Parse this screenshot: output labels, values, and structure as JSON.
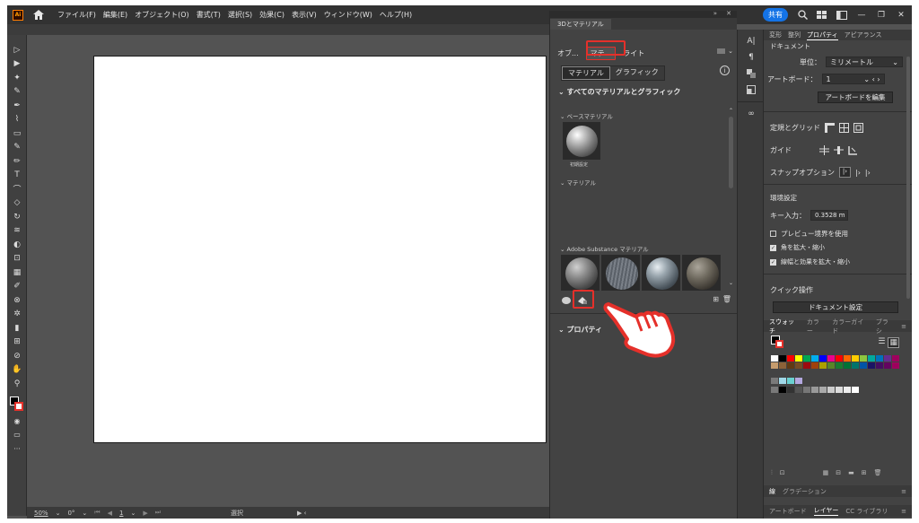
{
  "menubar": {
    "app_logo": "Ai",
    "items": [
      "ファイル(F)",
      "編集(E)",
      "オブジェクト(O)",
      "書式(T)",
      "選択(S)",
      "効果(C)",
      "表示(V)",
      "ウィンドウ(W)",
      "ヘルプ(H)"
    ],
    "share_label": "共有",
    "icons": [
      "search-icon",
      "arrange-icon",
      "panel-icon",
      "minimize-icon",
      "restore-icon",
      "close-icon"
    ]
  },
  "panel3d": {
    "tab_label": "3Dとマテリアル",
    "mode_tabs": [
      "オブ...",
      "マテ...",
      "ライト"
    ],
    "segments": [
      "マテリアル",
      "グラフィック"
    ],
    "all_header": "すべてのマテリアルとグラフィック",
    "base_header": "ベースマテリアル",
    "base_item_label": "初期設定",
    "material_header": "マテリアル",
    "substance_header": "Adobe Substance マテリアル",
    "properties_header": "プロパティ"
  },
  "props": {
    "tabs": [
      "変形",
      "整列",
      "プロパティ",
      "アピアランス"
    ],
    "active_tab": "プロパティ",
    "document_header": "ドキュメント",
    "unit_label": "単位：",
    "unit_value": "ミリメートル",
    "artboard_label": "アートボード：",
    "artboard_value": "1",
    "edit_artboard_btn": "アートボードを編集",
    "ruler_grid_label": "定規とグリッド",
    "guide_label": "ガイド",
    "snap_label": "スナップオプション",
    "prefs_header": "環境設定",
    "key_input_label": "キー入力：",
    "key_input_value": "0.3528 m",
    "preview_bounds": "プレビュー境界を使用",
    "scale_corners": "角を拡大・縮小",
    "scale_strokes": "線幅と効果を拡大・縮小",
    "quick_actions": "クイック操作",
    "doc_settings_btn": "ドキュメント設定"
  },
  "swatches": {
    "tabs": [
      "スウォッチ",
      "カラー",
      "カラーガイド",
      "ブラシ"
    ],
    "colors": [
      "#ffffff",
      "#000000",
      "#ff0000",
      "#ffff00",
      "#00a651",
      "#00aeef",
      "#0000ff",
      "#ec008c",
      "#ff0000",
      "#ff6600",
      "#ffcc00",
      "#8dc63f",
      "#00a99d",
      "#0072bc",
      "#662d91",
      "#9e005d",
      "#c69c6d",
      "#8c6239",
      "#603913",
      "#754c24",
      "#9e0b0f",
      "#a0410d",
      "#aba000",
      "#598527",
      "#1a7b30",
      "#007236",
      "#00746b",
      "#0054a6",
      "#1b1464",
      "#440e62",
      "#630460",
      "#9e005d"
    ]
  },
  "layers": {
    "tabs": [
      "線",
      "グラデーション"
    ],
    "bottom_tabs": [
      "アートボード",
      "レイヤー",
      "CC ライブラリ"
    ]
  },
  "status": {
    "zoom": "50%",
    "rotate": "0°",
    "page": "1",
    "mode": "選択"
  }
}
